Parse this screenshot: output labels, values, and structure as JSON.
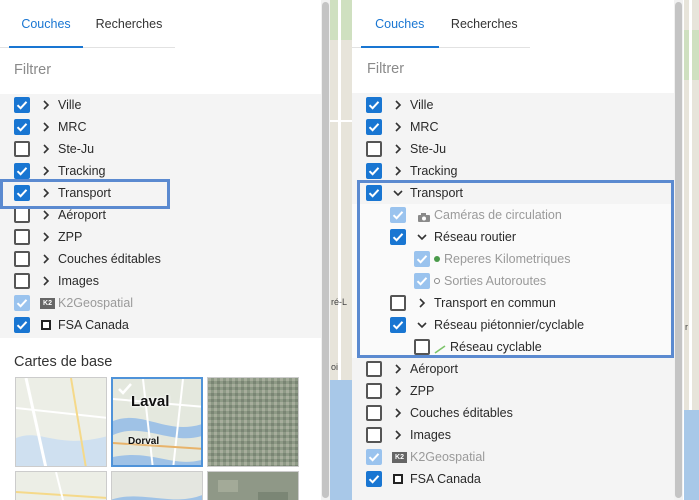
{
  "left": {
    "tabs": [
      "Couches",
      "Recherches"
    ],
    "filter_placeholder": "Filtrer",
    "layers": [
      {
        "label": "Ville",
        "checked": true
      },
      {
        "label": "MRC",
        "checked": true
      },
      {
        "label": "Ste-Ju",
        "checked": false
      },
      {
        "label": "Tracking",
        "checked": true
      },
      {
        "label": "Transport",
        "checked": true
      },
      {
        "label": "Aéroport",
        "checked": false
      },
      {
        "label": "ZPP",
        "checked": false
      },
      {
        "label": "Couches éditables",
        "checked": false
      },
      {
        "label": "Images",
        "checked": false
      },
      {
        "label": "K2Geospatial",
        "checked": true,
        "disabled": true
      },
      {
        "label": "FSA Canada",
        "checked": true
      }
    ],
    "base_maps_title": "Cartes de base",
    "base_maps": [
      {
        "name": "Laval",
        "sub": "Dorval",
        "selected": true
      }
    ]
  },
  "right": {
    "tabs": [
      "Couches",
      "Recherches"
    ],
    "filter_placeholder": "Filtrer",
    "layers": [
      {
        "label": "Ville",
        "checked": true
      },
      {
        "label": "MRC",
        "checked": true
      },
      {
        "label": "Ste-Ju",
        "checked": false
      },
      {
        "label": "Tracking",
        "checked": true
      },
      {
        "label": "Transport",
        "checked": true,
        "expanded": true
      },
      {
        "label": "Caméras de circulation",
        "checked": true,
        "disabled": true,
        "level": 1
      },
      {
        "label": "Réseau routier",
        "checked": true,
        "expanded": true,
        "level": 1
      },
      {
        "label": "Reperes Kilometriques",
        "checked": true,
        "disabled": true,
        "level": 2
      },
      {
        "label": "Sorties Autoroutes",
        "checked": true,
        "disabled": true,
        "level": 2
      },
      {
        "label": "Transport en commun",
        "checked": false,
        "level": 1
      },
      {
        "label": "Réseau piétonnier/cyclable",
        "checked": true,
        "expanded": true,
        "level": 1
      },
      {
        "label": "Réseau cyclable",
        "checked": false,
        "level": 2
      },
      {
        "label": "Aéroport",
        "checked": false
      },
      {
        "label": "ZPP",
        "checked": false
      },
      {
        "label": "Couches éditables",
        "checked": false
      },
      {
        "label": "Images",
        "checked": false
      },
      {
        "label": "K2Geospatial",
        "checked": true,
        "disabled": true
      },
      {
        "label": "FSA Canada",
        "checked": true
      }
    ]
  },
  "map_labels": [
    "ré-L",
    "oi",
    "r"
  ],
  "colors": {
    "accent": "#1976d2",
    "highlight": "#5b8ad0",
    "disabled_check": "#9ac3ee",
    "cycle_line": "#7cc46a",
    "marker_green": "#4a9a4a"
  }
}
